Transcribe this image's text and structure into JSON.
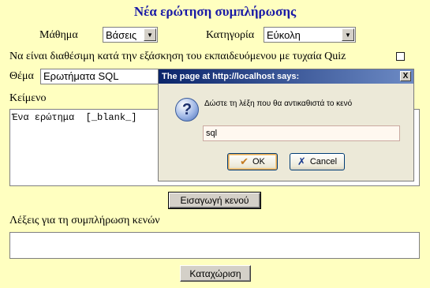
{
  "form": {
    "title": "Νέα ερώτηση συμπλήρωσης",
    "course_label": "Μάθημα",
    "course_value": "Βάσεις",
    "category_label": "Κατηγορία",
    "category_value": "Εύκολη",
    "quiz_label": "Να είναι διαθέσιμη κατά την εξάσκηση του εκπαιδευόμενου με τυχαία Quiz",
    "topic_label": "Θέμα",
    "topic_value": "Ερωτήματα SQL",
    "text_label": "Κείμενο",
    "text_value": "Ένα ερώτημα  [_blank_]",
    "insert_blank_button": "Εισαγωγή κενού",
    "words_label": "Λέξεις για τη συμπλήρωση κενών",
    "words_value": "",
    "submit_button": "Καταχώριση"
  },
  "dialog": {
    "title": "The page at http://localhost says:",
    "close": "X",
    "message": "Δώστε τη λέξη που θα αντικαθιστά το κενό",
    "input_value": "sql",
    "ok_label": "OK",
    "cancel_label": "Cancel"
  },
  "icons": {
    "question": "question-icon",
    "ok": "check-icon",
    "cancel": "x-icon",
    "dropdown": "chevron-down-icon"
  },
  "colors": {
    "page_bg": "#ffffc0",
    "title": "#1a1aa6",
    "dialog_titlebar": "#0a246a"
  }
}
